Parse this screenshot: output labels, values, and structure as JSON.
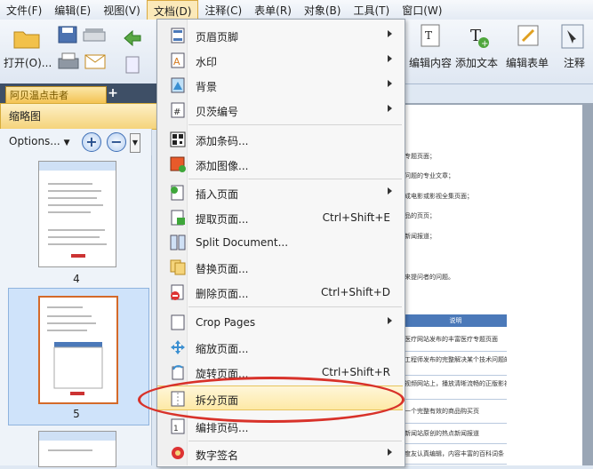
{
  "menubar": {
    "items": [
      "文件(F)",
      "编辑(E)",
      "视图(V)",
      "文档(D)",
      "注释(C)",
      "表单(R)",
      "对象(B)",
      "工具(T)",
      "窗口(W)"
    ],
    "active_index": 3
  },
  "toolbar": {
    "open_label": "打开(O)...",
    "edit_content_label": "编辑内容",
    "add_text_label": "添加文本",
    "edit_form_label": "编辑表单",
    "annotate_label": "注释"
  },
  "tab": {
    "title": "阿贝温点击者"
  },
  "panel": {
    "title": "缩略图",
    "options_label": "Options...",
    "thumbnails": [
      {
        "label": "4"
      },
      {
        "label": "5"
      }
    ],
    "selected_index": 1
  },
  "document": {
    "lines": [
      "专题页面；",
      "问题的专业文章；",
      "成电影或影视全集页面；",
      "品的页页；",
      "新闻报道；",
      "来提问者的问题。"
    ],
    "table_header": "说明",
    "table_rows": [
      "医疗网站发布的丰富医疗专题页面",
      "工程师发布的完整解决某个技术问题的专业",
      "视频网站上，播放清晰流畅的正版影视全集",
      "一个完整有效的商品购买页",
      "新闻站原创的热点新闻报道",
      "度友认真编辑，内容丰富的百科词条"
    ]
  },
  "menu": {
    "items": [
      {
        "label": "页眉页脚",
        "shortcut": "",
        "submenu": true,
        "icon": "header-footer-icon"
      },
      {
        "label": "水印",
        "shortcut": "",
        "submenu": true,
        "icon": "watermark-icon"
      },
      {
        "label": "背景",
        "shortcut": "",
        "submenu": true,
        "icon": "background-icon"
      },
      {
        "label": "贝茨编号",
        "shortcut": "",
        "submenu": true,
        "icon": "bates-number-icon"
      },
      {
        "label": "添加条码...",
        "shortcut": "",
        "submenu": false,
        "icon": "barcode-icon"
      },
      {
        "label": "添加图像...",
        "shortcut": "",
        "submenu": false,
        "icon": "add-image-icon"
      },
      {
        "label": "插入页面",
        "shortcut": "",
        "submenu": true,
        "icon": "insert-page-icon"
      },
      {
        "label": "提取页面...",
        "shortcut": "Ctrl+Shift+E",
        "submenu": false,
        "icon": "extract-page-icon"
      },
      {
        "label": "Split Document...",
        "shortcut": "",
        "submenu": false,
        "icon": "split-document-icon"
      },
      {
        "label": "替换页面...",
        "shortcut": "",
        "submenu": false,
        "icon": "replace-page-icon"
      },
      {
        "label": "删除页面...",
        "shortcut": "Ctrl+Shift+D",
        "submenu": false,
        "icon": "delete-page-icon"
      },
      {
        "label": "Crop Pages",
        "shortcut": "",
        "submenu": true,
        "icon": "crop-pages-icon"
      },
      {
        "label": "缩放页面...",
        "shortcut": "",
        "submenu": false,
        "icon": "resize-page-icon"
      },
      {
        "label": "旋转页面...",
        "shortcut": "Ctrl+Shift+R",
        "submenu": false,
        "icon": "rotate-page-icon"
      },
      {
        "label": "拆分页面",
        "shortcut": "",
        "submenu": false,
        "icon": "split-page-icon"
      },
      {
        "label": "编排页码...",
        "shortcut": "",
        "submenu": false,
        "icon": "page-numbering-icon"
      },
      {
        "label": "数字签名",
        "shortcut": "",
        "submenu": true,
        "icon": "digital-signature-icon"
      }
    ],
    "highlighted_index": 14,
    "accent": "#d8322a"
  }
}
